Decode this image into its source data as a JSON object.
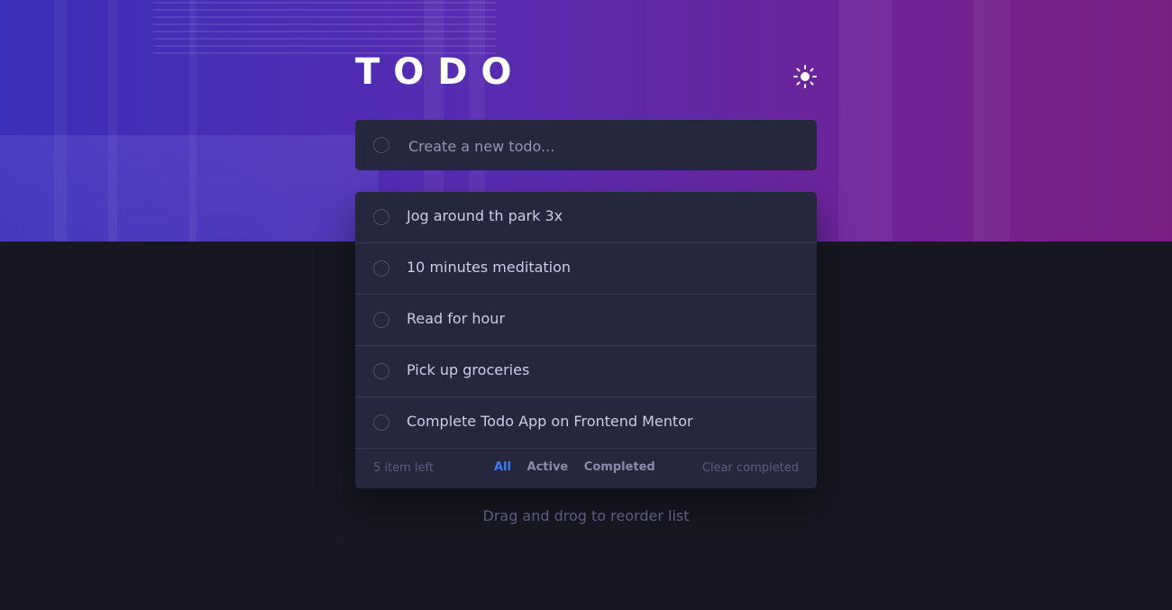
{
  "header": {
    "title": "TODO",
    "theme_toggle_icon": "sun-icon"
  },
  "new_todo": {
    "placeholder": "Create a new todo...",
    "value": ""
  },
  "todos": [
    {
      "text": "Jog around th park 3x",
      "completed": false
    },
    {
      "text": "10 minutes meditation",
      "completed": false
    },
    {
      "text": "Read for hour",
      "completed": false
    },
    {
      "text": "Pick up groceries",
      "completed": false
    },
    {
      "text": "Complete Todo App on Frontend Mentor",
      "completed": false
    }
  ],
  "footer": {
    "items_left": "5 item left",
    "filters": [
      "All",
      "Active",
      "Completed"
    ],
    "active_filter": "All",
    "clear_label": "Clear completed"
  },
  "hint": "Drag and drog to reorder list",
  "colors": {
    "accent": "#3a7bfd",
    "card": "#25273c",
    "background": "#181824"
  }
}
